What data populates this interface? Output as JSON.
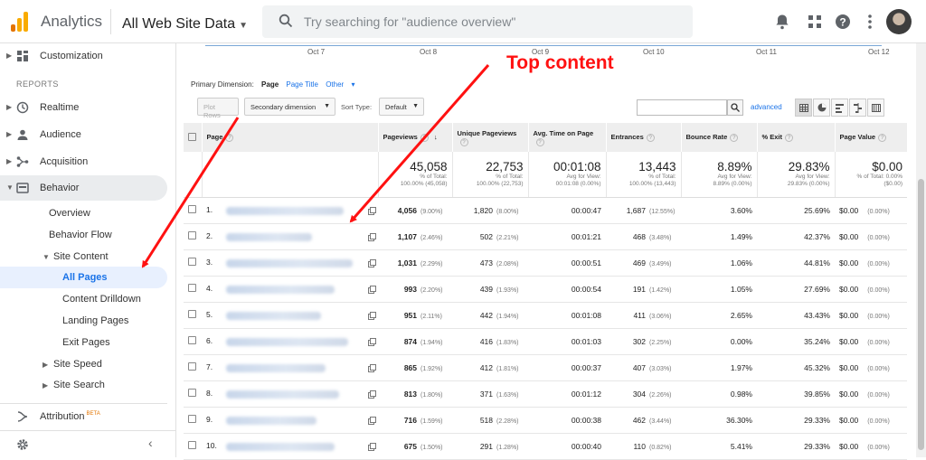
{
  "header": {
    "app_title": "Analytics",
    "account": "All Web Site Data",
    "search_placeholder": "Try searching for \"audience overview\""
  },
  "sidebar": {
    "customization": "Customization",
    "reports_heading": "REPORTS",
    "realtime": "Realtime",
    "audience": "Audience",
    "acquisition": "Acquisition",
    "behavior": "Behavior",
    "overview": "Overview",
    "behavior_flow": "Behavior Flow",
    "site_content": "Site Content",
    "all_pages": "All Pages",
    "content_drilldown": "Content Drilldown",
    "landing_pages": "Landing Pages",
    "exit_pages": "Exit Pages",
    "site_speed": "Site Speed",
    "site_search": "Site Search",
    "attribution": "Attribution",
    "beta": "BETA"
  },
  "timeline": {
    "ticks": [
      "Oct 7",
      "Oct 8",
      "Oct 9",
      "Oct 10",
      "Oct 11",
      "Oct 12"
    ]
  },
  "dimensions": {
    "label": "Primary Dimension:",
    "active": "Page",
    "page_title": "Page Title",
    "other": "Other"
  },
  "controls": {
    "plot_rows": "Plot Rows",
    "secondary_dimension": "Secondary dimension",
    "sort_type_label": "Sort Type:",
    "sort_default": "Default",
    "advanced": "advanced"
  },
  "table": {
    "headers": {
      "page": "Page",
      "pageviews": "Pageviews",
      "unique_pageviews": "Unique Pageviews",
      "avg_time": "Avg. Time on Page",
      "entrances": "Entrances",
      "bounce_rate": "Bounce Rate",
      "exit": "% Exit",
      "page_value": "Page Value"
    },
    "totals": {
      "pageviews": "45,058",
      "pageviews_sub1": "% of Total:",
      "pageviews_sub2": "100.00% (45,058)",
      "unique": "22,753",
      "unique_sub1": "% of Total:",
      "unique_sub2": "100.00% (22,753)",
      "avg_time": "00:01:08",
      "avg_time_sub1": "Avg for View:",
      "avg_time_sub2": "00:01:08 (0.00%)",
      "entrances": "13,443",
      "entrances_sub1": "% of Total:",
      "entrances_sub2": "100.00% (13,443)",
      "bounce": "8.89%",
      "bounce_sub1": "Avg for View:",
      "bounce_sub2": "8.89% (0.00%)",
      "exit": "29.83%",
      "exit_sub1": "Avg for View:",
      "exit_sub2": "29.83% (0.00%)",
      "value": "$0.00",
      "value_sub1": "% of Total: 0.00%",
      "value_sub2": "($0.00)"
    },
    "rows": [
      {
        "n": "1.",
        "pv": "4,056",
        "pv_pct": "(9.00%)",
        "upv": "1,820",
        "upv_pct": "(8.00%)",
        "time": "00:00:47",
        "ent": "1,687",
        "ent_pct": "(12.55%)",
        "bounce": "3.60%",
        "exit": "25.69%",
        "val": "$0.00",
        "val_pct": "(0.00%)"
      },
      {
        "n": "2.",
        "pv": "1,107",
        "pv_pct": "(2.46%)",
        "upv": "502",
        "upv_pct": "(2.21%)",
        "time": "00:01:21",
        "ent": "468",
        "ent_pct": "(3.48%)",
        "bounce": "1.49%",
        "exit": "42.37%",
        "val": "$0.00",
        "val_pct": "(0.00%)"
      },
      {
        "n": "3.",
        "pv": "1,031",
        "pv_pct": "(2.29%)",
        "upv": "473",
        "upv_pct": "(2.08%)",
        "time": "00:00:51",
        "ent": "469",
        "ent_pct": "(3.49%)",
        "bounce": "1.06%",
        "exit": "44.81%",
        "val": "$0.00",
        "val_pct": "(0.00%)"
      },
      {
        "n": "4.",
        "pv": "993",
        "pv_pct": "(2.20%)",
        "upv": "439",
        "upv_pct": "(1.93%)",
        "time": "00:00:54",
        "ent": "191",
        "ent_pct": "(1.42%)",
        "bounce": "1.05%",
        "exit": "27.69%",
        "val": "$0.00",
        "val_pct": "(0.00%)"
      },
      {
        "n": "5.",
        "pv": "951",
        "pv_pct": "(2.11%)",
        "upv": "442",
        "upv_pct": "(1.94%)",
        "time": "00:01:08",
        "ent": "411",
        "ent_pct": "(3.06%)",
        "bounce": "2.65%",
        "exit": "43.43%",
        "val": "$0.00",
        "val_pct": "(0.00%)"
      },
      {
        "n": "6.",
        "pv": "874",
        "pv_pct": "(1.94%)",
        "upv": "416",
        "upv_pct": "(1.83%)",
        "time": "00:01:03",
        "ent": "302",
        "ent_pct": "(2.25%)",
        "bounce": "0.00%",
        "exit": "35.24%",
        "val": "$0.00",
        "val_pct": "(0.00%)"
      },
      {
        "n": "7.",
        "pv": "865",
        "pv_pct": "(1.92%)",
        "upv": "412",
        "upv_pct": "(1.81%)",
        "time": "00:00:37",
        "ent": "407",
        "ent_pct": "(3.03%)",
        "bounce": "1.97%",
        "exit": "45.32%",
        "val": "$0.00",
        "val_pct": "(0.00%)"
      },
      {
        "n": "8.",
        "pv": "813",
        "pv_pct": "(1.80%)",
        "upv": "371",
        "upv_pct": "(1.63%)",
        "time": "00:01:12",
        "ent": "304",
        "ent_pct": "(2.26%)",
        "bounce": "0.98%",
        "exit": "39.85%",
        "val": "$0.00",
        "val_pct": "(0.00%)"
      },
      {
        "n": "9.",
        "pv": "716",
        "pv_pct": "(1.59%)",
        "upv": "518",
        "upv_pct": "(2.28%)",
        "time": "00:00:38",
        "ent": "462",
        "ent_pct": "(3.44%)",
        "bounce": "36.30%",
        "exit": "29.33%",
        "val": "$0.00",
        "val_pct": "(0.00%)"
      },
      {
        "n": "10.",
        "pv": "675",
        "pv_pct": "(1.50%)",
        "upv": "291",
        "upv_pct": "(1.28%)",
        "time": "00:00:40",
        "ent": "110",
        "ent_pct": "(0.82%)",
        "bounce": "5.41%",
        "exit": "29.33%",
        "val": "$0.00",
        "val_pct": "(0.00%)"
      }
    ]
  },
  "annotation": {
    "text": "Top content",
    "color": "#ff1111"
  },
  "colors": {
    "accent": "#1a73e8",
    "logo_orange": "#f9ab00",
    "logo_dark_orange": "#e37400",
    "selected_bg": "#e8f0fe"
  }
}
